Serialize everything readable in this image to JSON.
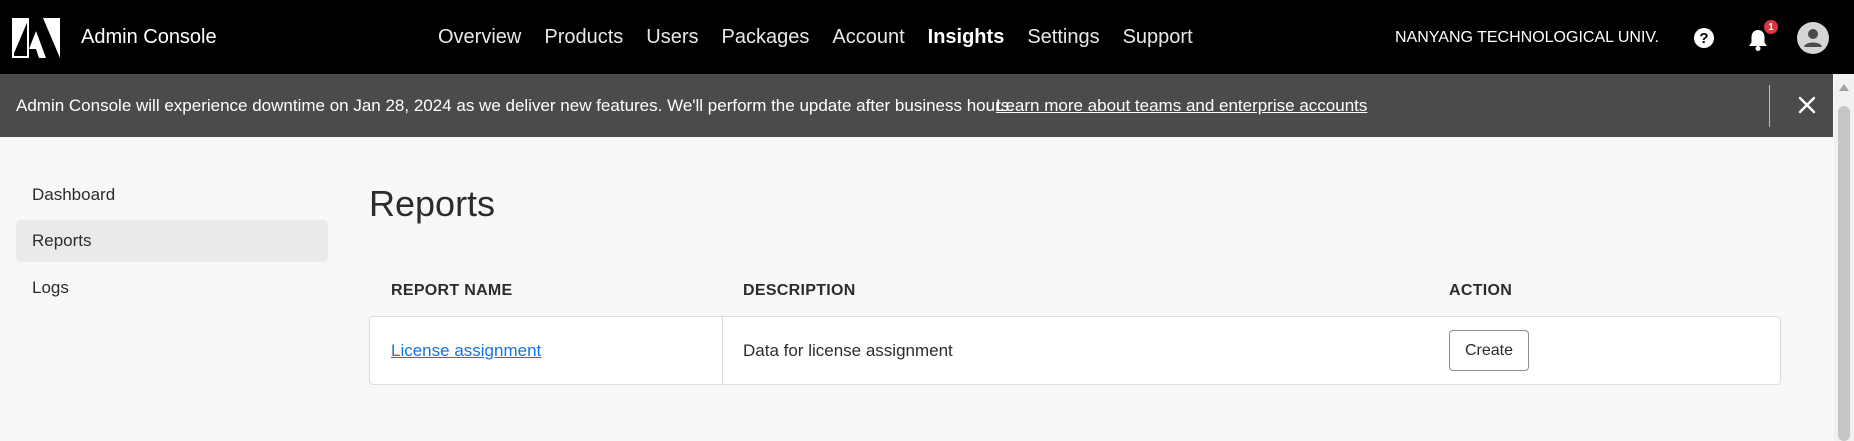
{
  "header": {
    "app_title": "Admin Console",
    "nav": [
      "Overview",
      "Products",
      "Users",
      "Packages",
      "Account",
      "Insights",
      "Settings",
      "Support"
    ],
    "active_nav": "Insights",
    "org_name": "NANYANG TECHNOLOGICAL UNIV.",
    "notification_count": "1"
  },
  "banner": {
    "message": "Admin Console will experience downtime on Jan 28, 2024 as we deliver new features. We'll perform the update after business hours.",
    "link": "Learn more about teams and enterprise accounts"
  },
  "sidebar": {
    "items": [
      {
        "label": "Dashboard"
      },
      {
        "label": "Reports",
        "selected": true
      },
      {
        "label": "Logs"
      }
    ]
  },
  "main": {
    "title": "Reports",
    "columns": [
      "REPORT NAME",
      "DESCRIPTION",
      "ACTION"
    ],
    "rows": [
      {
        "name": "License assignment",
        "description": "Data for license assignment",
        "action": "Create"
      }
    ]
  },
  "colors": {
    "topbar": "#000000",
    "banner": "#4b4b4b",
    "link": "#1473e6",
    "badge": "#d7373f"
  },
  "icons": [
    "adobe-logo",
    "help-icon",
    "bell-icon",
    "avatar-icon",
    "close-icon"
  ]
}
